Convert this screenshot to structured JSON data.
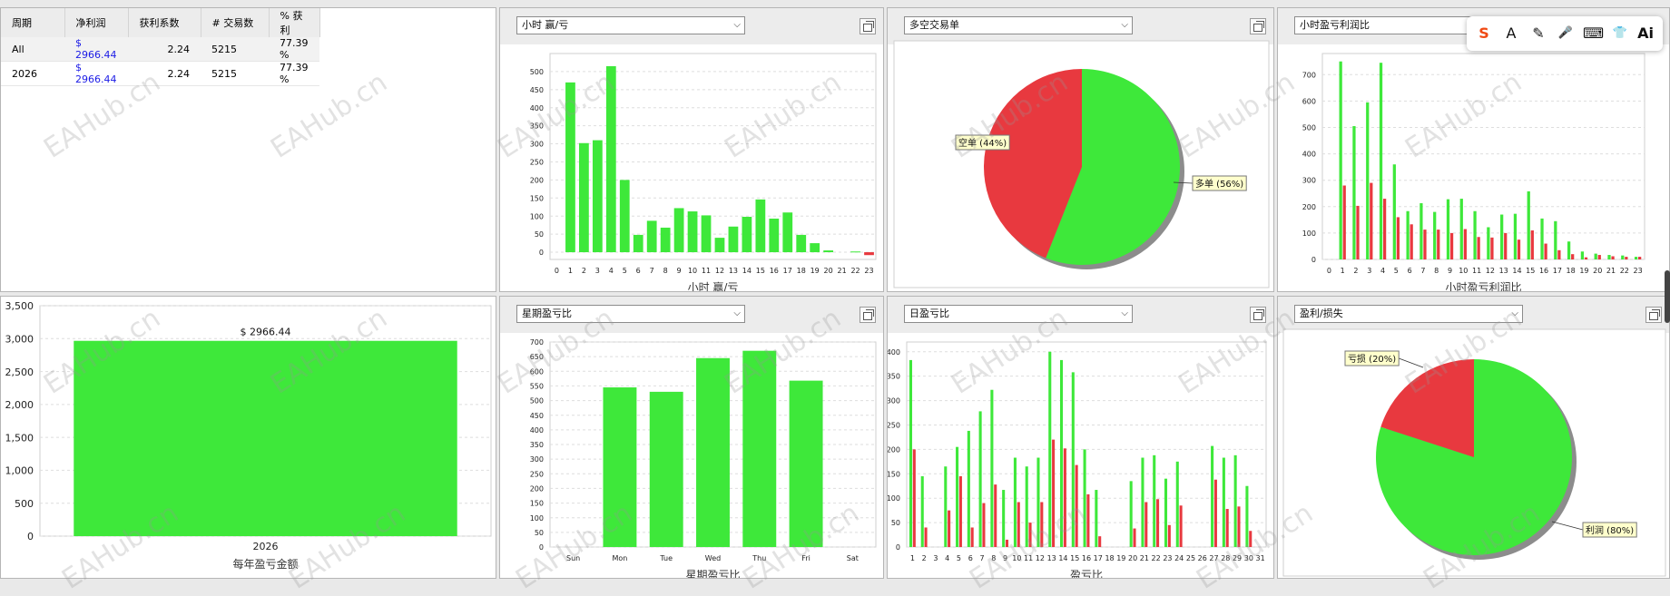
{
  "watermark": "EAHub.cn",
  "colors": {
    "win": "#3ee83a",
    "loss": "#e8393f"
  },
  "summary": {
    "headers": [
      "周期",
      "净利润",
      "获利系数",
      "# 交易数",
      "% 获利"
    ],
    "rows": [
      [
        "All",
        "$ 2966.44",
        "2.24",
        "5215",
        "77.39 %"
      ],
      [
        "2026",
        "$ 2966.44",
        "2.24",
        "5215",
        "77.39 %"
      ]
    ]
  },
  "panels": {
    "hourly": {
      "dropdown": "小时 赢/亏"
    },
    "longshort": {
      "dropdown": "多空交易单"
    },
    "hourly_ratio": {
      "dropdown": "小时盈亏利润比"
    },
    "weekday": {
      "dropdown": "星期盈亏比"
    },
    "daily": {
      "dropdown": "日盈亏比"
    },
    "profitloss": {
      "dropdown": "盈利/损失"
    }
  },
  "toolbar": {
    "icons": [
      "s-logo-icon",
      "font-icon",
      "pen-icon",
      "mic-icon",
      "keyboard-icon",
      "shirt-icon",
      "ai-icon"
    ],
    "labels": [
      "S",
      "A",
      "✎",
      "🎤",
      "⌨",
      "👕",
      "Ai"
    ]
  },
  "chart_data": [
    {
      "id": "hourly",
      "type": "bar",
      "xlabel": "小时 赢/亏",
      "ylim": [
        -20,
        550
      ],
      "yticks": [
        0,
        50,
        100,
        150,
        200,
        250,
        300,
        350,
        400,
        450,
        500
      ],
      "categories": [
        "0",
        "1",
        "2",
        "3",
        "4",
        "5",
        "6",
        "7",
        "8",
        "9",
        "10",
        "11",
        "12",
        "13",
        "14",
        "15",
        "16",
        "17",
        "18",
        "19",
        "20",
        "21",
        "22",
        "23"
      ],
      "values": [
        0,
        470,
        302,
        310,
        515,
        200,
        48,
        87,
        68,
        122,
        113,
        102,
        40,
        71,
        98,
        146,
        93,
        110,
        48,
        25,
        5,
        0,
        2,
        -8
      ]
    },
    {
      "id": "longshort",
      "type": "pie",
      "slices": [
        {
          "label": "多单 (56%)",
          "value": 56,
          "color": "win"
        },
        {
          "label": "空单 (44%)",
          "value": 44,
          "color": "loss"
        }
      ]
    },
    {
      "id": "hourly_ratio",
      "type": "bar",
      "xlabel": "小时盈亏利润比",
      "ylim": [
        0,
        780
      ],
      "yticks": [
        0,
        100,
        200,
        300,
        400,
        500,
        600,
        700
      ],
      "categories": [
        "0",
        "1",
        "2",
        "3",
        "4",
        "5",
        "6",
        "7",
        "8",
        "9",
        "10",
        "11",
        "12",
        "13",
        "14",
        "15",
        "16",
        "17",
        "18",
        "19",
        "20",
        "21",
        "22",
        "23"
      ],
      "series": [
        {
          "color": "win",
          "values": [
            0,
            750,
            505,
            595,
            745,
            360,
            183,
            213,
            180,
            228,
            230,
            183,
            122,
            170,
            173,
            258,
            155,
            145,
            68,
            30,
            22,
            17,
            15,
            10
          ]
        },
        {
          "color": "loss",
          "values": [
            0,
            280,
            203,
            290,
            230,
            160,
            133,
            113,
            113,
            100,
            115,
            85,
            83,
            100,
            75,
            110,
            60,
            35,
            20,
            8,
            17,
            12,
            10,
            10
          ]
        }
      ]
    },
    {
      "id": "yearly",
      "type": "bar",
      "xlabel": "每年盈亏金额",
      "ylim": [
        0,
        3500
      ],
      "yticks": [
        0,
        500,
        1000,
        1500,
        2000,
        2500,
        3000,
        3500
      ],
      "categories": [
        "2026"
      ],
      "values": [
        2966.44
      ],
      "data_labels": [
        "$ 2966.44"
      ]
    },
    {
      "id": "weekday",
      "type": "bar",
      "xlabel": "星期盈亏比",
      "ylim": [
        0,
        700
      ],
      "yticks": [
        0,
        50,
        100,
        150,
        200,
        250,
        300,
        350,
        400,
        450,
        500,
        550,
        600,
        650,
        700
      ],
      "categories": [
        "Sun",
        "Mon",
        "Tue",
        "Wed",
        "Thu",
        "Fri",
        "Sat"
      ],
      "values": [
        0,
        545,
        530,
        645,
        670,
        568,
        0
      ]
    },
    {
      "id": "daily",
      "type": "bar",
      "xlabel": "盈亏比",
      "ylim": [
        0,
        420
      ],
      "yticks": [
        0,
        50,
        100,
        150,
        200,
        250,
        300,
        350,
        400
      ],
      "categories": [
        "1",
        "2",
        "3",
        "4",
        "5",
        "6",
        "7",
        "8",
        "9",
        "10",
        "11",
        "12",
        "13",
        "14",
        "15",
        "16",
        "17",
        "18",
        "19",
        "20",
        "21",
        "22",
        "23",
        "24",
        "25",
        "26",
        "27",
        "28",
        "29",
        "30",
        "31"
      ],
      "series": [
        {
          "color": "win",
          "values": [
            383,
            145,
            0,
            165,
            205,
            238,
            278,
            322,
            117,
            183,
            165,
            183,
            400,
            383,
            358,
            200,
            117,
            0,
            0,
            135,
            183,
            188,
            140,
            175,
            0,
            0,
            207,
            183,
            188,
            125,
            0
          ]
        },
        {
          "color": "loss",
          "values": [
            200,
            40,
            0,
            75,
            145,
            40,
            90,
            128,
            15,
            92,
            50,
            92,
            220,
            202,
            168,
            108,
            22,
            0,
            0,
            38,
            92,
            98,
            45,
            85,
            0,
            0,
            138,
            78,
            83,
            33,
            0
          ]
        }
      ]
    },
    {
      "id": "profitloss",
      "type": "pie",
      "slices": [
        {
          "label": "利润 (80%)",
          "value": 80,
          "color": "win"
        },
        {
          "label": "亏损 (20%)",
          "value": 20,
          "color": "loss"
        }
      ]
    }
  ]
}
